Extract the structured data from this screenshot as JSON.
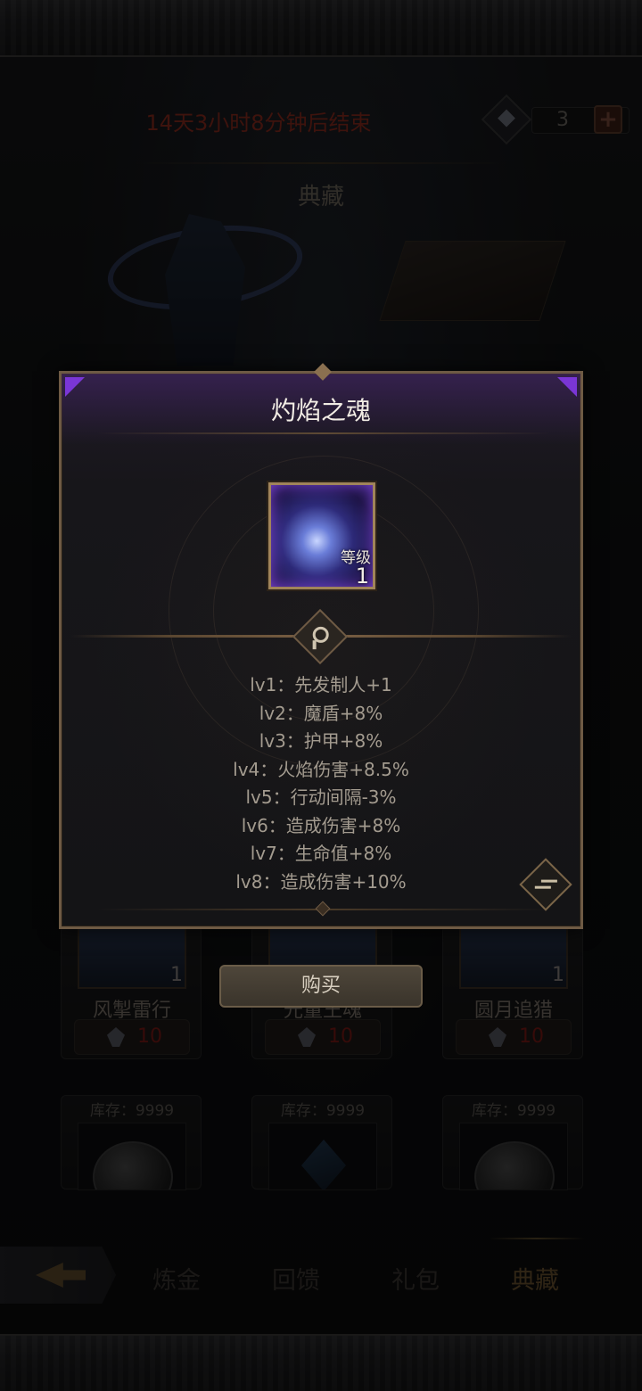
{
  "header": {
    "timer_text": "14天3小时8分钟后结束",
    "currency_amount": "3",
    "section_title": "典藏"
  },
  "shop": {
    "items": [
      {
        "name": "风掣雷行",
        "level": "1",
        "price": "10"
      },
      {
        "name": "光量王魂",
        "level": "1",
        "price": "10"
      },
      {
        "name": "圆月追猎",
        "level": "1",
        "price": "10"
      }
    ],
    "stock_items": [
      {
        "stock_label": "库存：9999"
      },
      {
        "stock_label": "库存：9999"
      },
      {
        "stock_label": "库存：9999"
      }
    ],
    "buy_label": "购买"
  },
  "modal": {
    "title": "灼焰之魂",
    "level_label": "等级",
    "level_value": "1",
    "levels": [
      "lv1：先发制人+1",
      "lv2：魔盾+8%",
      "lv3：护甲+8%",
      "lv4：火焰伤害+8.5%",
      "lv5：行动间隔-3%",
      "lv6：造成伤害+8%",
      "lv7：生命值+8%",
      "lv8：造成伤害+10%"
    ]
  },
  "nav": {
    "tabs": [
      "炼金",
      "回馈",
      "礼包",
      "典藏"
    ],
    "active_tab": "典藏"
  },
  "colors": {
    "timer": "#8a2a1e",
    "price": "#7a1a14",
    "modal_border": "#6e5a44",
    "modal_accent": "#7a36d6"
  }
}
